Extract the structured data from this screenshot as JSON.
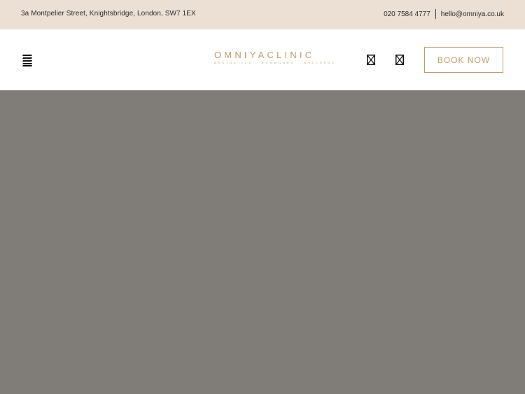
{
  "topbar": {
    "address": "3a Montpelier Street, Knightsbridge, London, SW7 1EX",
    "phone": "020 7584 4777",
    "email": "hello@omniya.co.uk"
  },
  "header": {
    "menu_icon": "hamburger-menu-icon",
    "logo": {
      "wordmark": "OMNIYACLINIC",
      "tagline": "AESTHETICS · HORMONES · WELLNESS"
    },
    "icons": [
      "missing-glyph-icon",
      "missing-glyph-icon"
    ],
    "book_label": "BOOK NOW"
  },
  "colors": {
    "topbar_bg": "#ebe0d3",
    "accent": "#c49a6c",
    "hero_bg": "#807d78"
  }
}
